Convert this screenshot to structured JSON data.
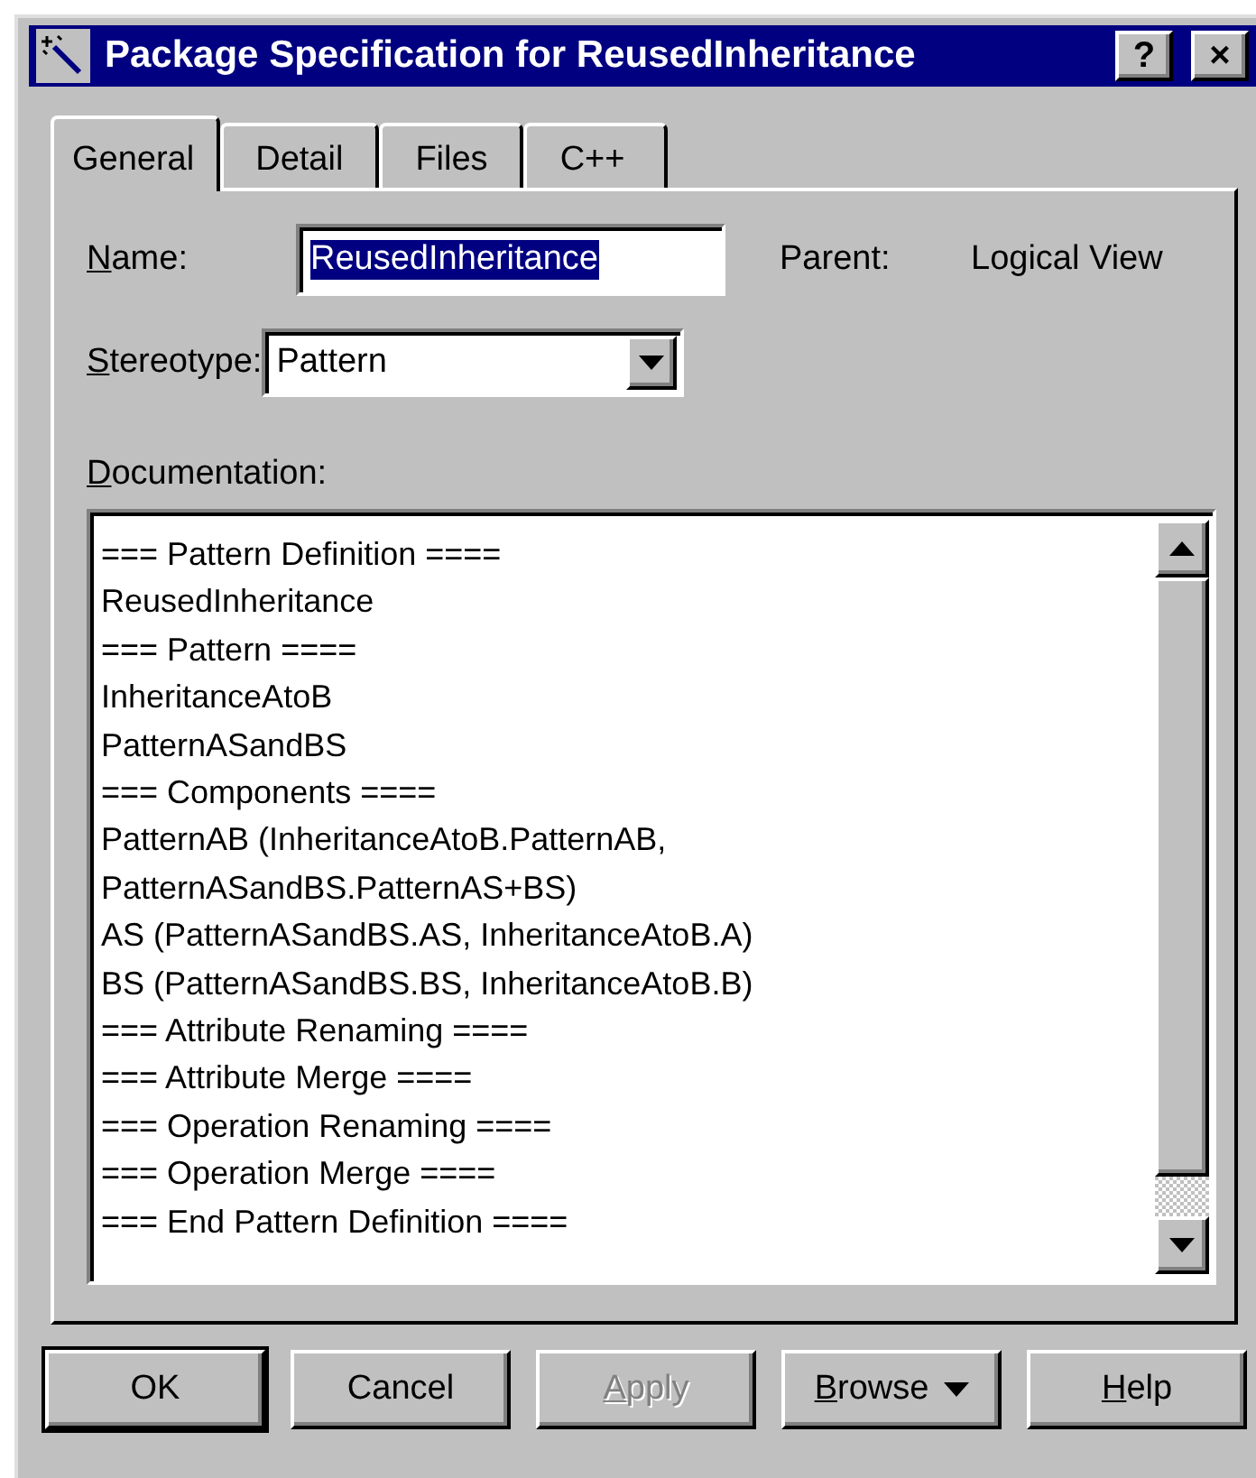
{
  "window": {
    "title": "Package Specification for ReusedInheritance",
    "help_button": "?",
    "close_button": "×"
  },
  "tabs": [
    {
      "label": "General",
      "selected": true
    },
    {
      "label": "Detail",
      "selected": false
    },
    {
      "label": "Files",
      "selected": false
    },
    {
      "label": "C++",
      "selected": false
    }
  ],
  "name": {
    "label": "Name:",
    "mnemonic": true,
    "value": "ReusedInheritance",
    "text_selected": true
  },
  "parent": {
    "label": "Parent:",
    "value": "Logical View"
  },
  "stereotype": {
    "label": "Stereotype:",
    "mnemonic": true,
    "value": "Pattern"
  },
  "documentation": {
    "label": "Documentation:",
    "mnemonic": true,
    "lines": [
      "=== Pattern Definition ====",
      "ReusedInheritance",
      "=== Pattern ====",
      "InheritanceAtoB",
      "PatternASandBS",
      "=== Components ====",
      "PatternAB (InheritanceAtoB.PatternAB,",
      "PatternASandBS.PatternAS+BS)",
      "AS (PatternASandBS.AS, InheritanceAtoB.A)",
      "BS (PatternASandBS.BS, InheritanceAtoB.B)",
      "=== Attribute Renaming ====",
      "=== Attribute Merge ====",
      "=== Operation Renaming ====",
      "=== Operation Merge ====",
      "=== End Pattern Definition ===="
    ]
  },
  "buttons": [
    {
      "label": "OK",
      "kind": "default",
      "mnemonic": false,
      "disabled": false
    },
    {
      "label": "Cancel",
      "kind": "plain",
      "mnemonic": false,
      "disabled": false
    },
    {
      "label": "Apply",
      "kind": "plain",
      "mnemonic": true,
      "disabled": true
    },
    {
      "label": "Browse",
      "kind": "menu",
      "mnemonic": true,
      "disabled": false
    },
    {
      "label": "Help",
      "kind": "plain",
      "mnemonic": true,
      "disabled": false
    }
  ]
}
